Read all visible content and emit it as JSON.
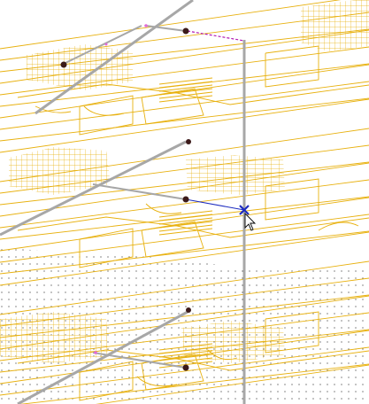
{
  "viewport": {
    "view_type": "3D isometric view",
    "background_color": "#ffffff"
  },
  "colors": {
    "floorplan_linework": "#e8b10f",
    "column_gray": "#a7a7a7",
    "snap_marker": "#1c2bbf",
    "selection_dash": "#b21ab2",
    "node_dot": "#3b1a1a",
    "node_highlight": "#e06bd7",
    "hatch_dots": "#000000"
  },
  "cursor": {
    "type": "arrow-pointer",
    "snap_indicator": "x-snap-marker"
  },
  "icons": [
    "snap-x-icon",
    "cursor-arrow-icon"
  ]
}
